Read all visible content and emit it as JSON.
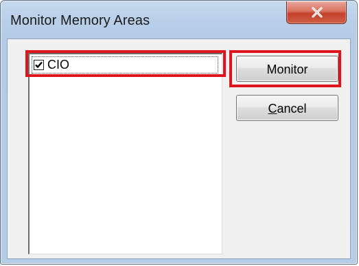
{
  "window": {
    "title": "Monitor Memory Areas",
    "close_icon": "close-icon"
  },
  "list": {
    "items": [
      {
        "label": "CIO",
        "checked": true
      }
    ]
  },
  "buttons": {
    "monitor_label": "Monitor",
    "cancel_label_mnemonic": "C",
    "cancel_label_rest": "ancel"
  },
  "colors": {
    "highlight": "#e0141c",
    "close_button": "#c4402a",
    "frame": "#b9cfe9",
    "client": "#f0f0f0"
  }
}
